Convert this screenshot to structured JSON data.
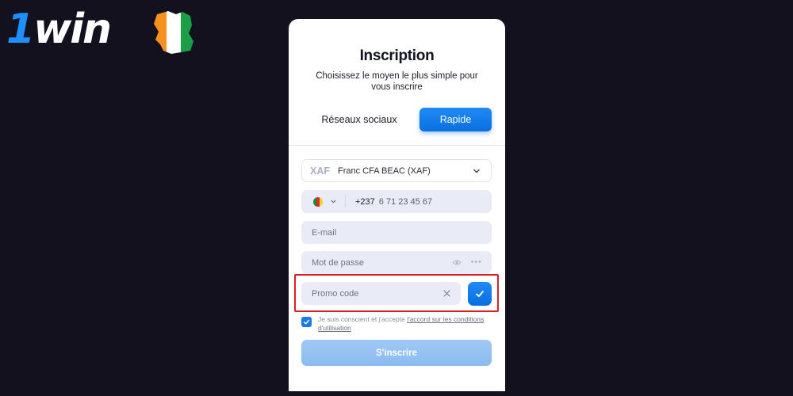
{
  "brand": {
    "logo_prefix": "1",
    "logo_word": "win",
    "colors": {
      "accent": "#1e8fff",
      "background": "#14111f"
    }
  },
  "form": {
    "title": "Inscription",
    "subtitle": "Choisissez le moyen le plus simple pour vous inscrire",
    "tabs": [
      {
        "label": "Réseaux sociaux",
        "selected": false
      },
      {
        "label": "Rapide",
        "selected": true
      }
    ],
    "currency": {
      "code": "XAF",
      "label": "Franc CFA BEAC (XAF)"
    },
    "phone": {
      "country_icon": "cameroon-flag-icon",
      "prefix": "+237",
      "placeholder": "6 71 23 45 67"
    },
    "email": {
      "placeholder": "E-mail"
    },
    "password": {
      "placeholder": "Mot de passe"
    },
    "promo": {
      "placeholder": "Promo code"
    },
    "terms": {
      "checked": true,
      "text": "Je suis conscient et j'accepte ",
      "link": "l'accord sur les conditions d'utilisation"
    },
    "submit_label": "S'inscrire"
  }
}
